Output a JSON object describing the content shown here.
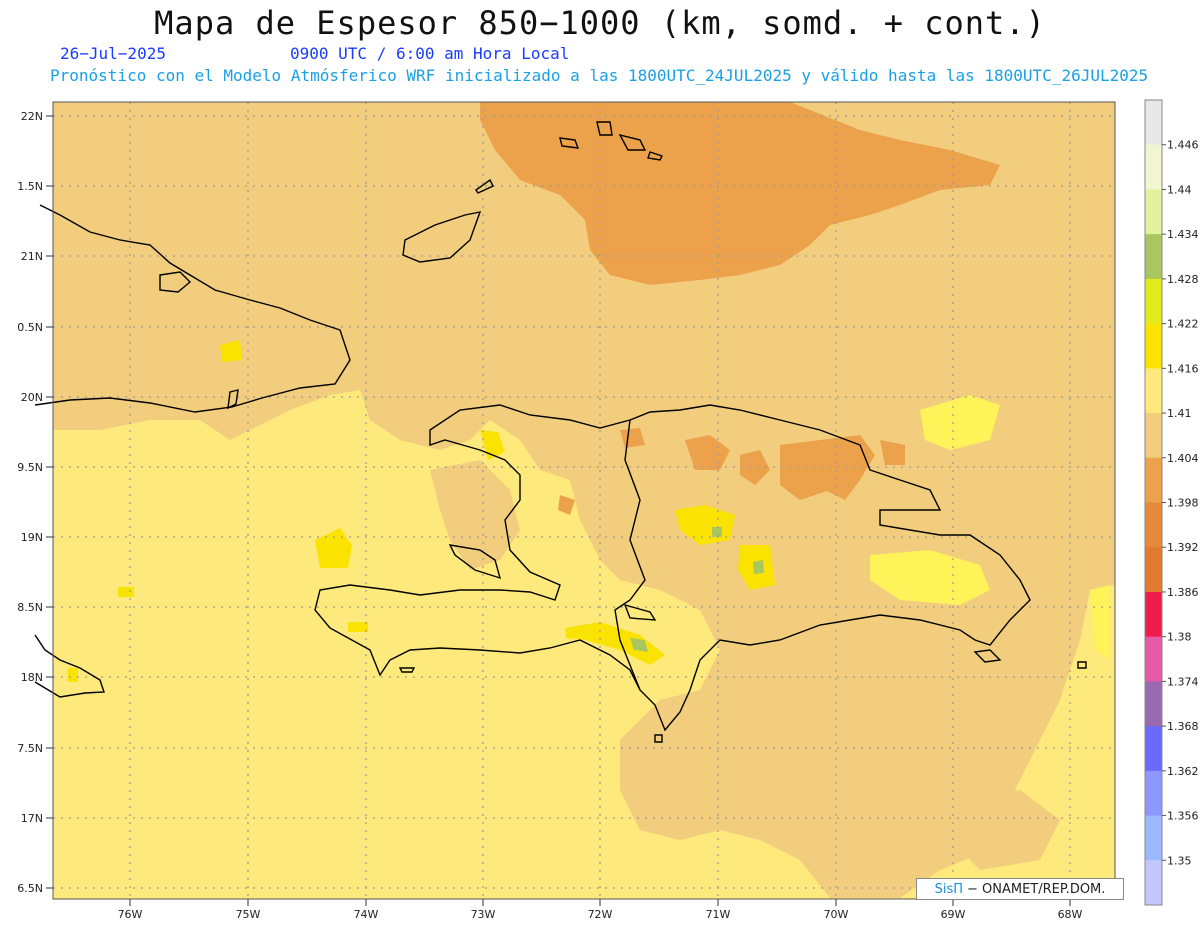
{
  "header": {
    "title": "Mapa de Espesor 850−1000 (km, somd. + cont.)",
    "date": "26−Jul−2025",
    "time": "0900 UTC / 6:00 am Hora Local",
    "model_line": "Pronóstico con el Modelo Atmósferico WRF inicializado a las 1800UTC_24JUL2025 y válido hasta las  1800UTC_26JUL2025"
  },
  "map": {
    "lat_labels": [
      "22N",
      "1.5N",
      "21N",
      "0.5N",
      "20N",
      "9.5N",
      "19N",
      "8.5N",
      "18N",
      "7.5N",
      "17N",
      "6.5N"
    ],
    "lon_labels": [
      "76W",
      "75W",
      "74W",
      "73W",
      "72W",
      "71W",
      "70W",
      "69W",
      "68W"
    ],
    "fill_colors": {
      "background": "#fde97c",
      "tan": "#f2cd7e",
      "orange": "#eba24a",
      "yellow": "#fae301",
      "green": "#a9c660",
      "bright_yellow": "#fff35a"
    }
  },
  "colorbar": {
    "labels": [
      "1.446",
      "1.44",
      "1.434",
      "1.428",
      "1.422",
      "1.416",
      "1.41",
      "1.404",
      "1.398",
      "1.392",
      "1.386",
      "1.38",
      "1.374",
      "1.368",
      "1.362",
      "1.356",
      "1.35"
    ],
    "colors": [
      "#e8e8e8",
      "#f2f4d2",
      "#e2f29c",
      "#a9c660",
      "#e2ea1e",
      "#fae301",
      "#fde97c",
      "#f2cd7e",
      "#eba24a",
      "#e68a3a",
      "#e27a30",
      "#ee1c4a",
      "#e65aa6",
      "#9a6ab0",
      "#6a6aff",
      "#8c98ff",
      "#9cb8ff",
      "#c2c8ff"
    ]
  },
  "credit": {
    "brand": "SisΠ",
    "text": "− ONAMET/REP.DOM."
  }
}
